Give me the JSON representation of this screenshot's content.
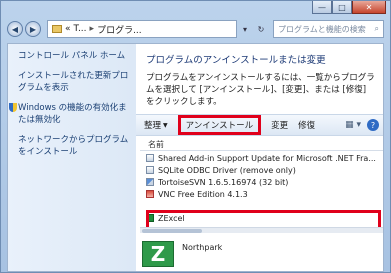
{
  "window": {
    "caption_minimize": "—",
    "caption_maximize": "□",
    "caption_close": "✕"
  },
  "address_bar": {
    "icon": "folder-icon",
    "part1": "«",
    "part2": "T...",
    "separator": "▸",
    "part3": "プログラ...",
    "dropdown": "▾",
    "refresh": "↻",
    "search_placeholder": "プログラムと機能の検索",
    "search_icon": "⌕"
  },
  "sidebar": {
    "items": [
      {
        "label": "コントロール パネル ホーム"
      },
      {
        "label": "インストールされた更新プログラムを表示"
      },
      {
        "label": "Windows の機能の有効化または無効化"
      },
      {
        "label": "ネットワークからプログラムをインストール"
      }
    ]
  },
  "main": {
    "title": "プログラムのアンインストールまたは変更",
    "description": "プログラムをアンインストールするには、一覧からプログラムを選択して [アンインストール]、[変更]、または [修復] をクリックします。"
  },
  "toolbar": {
    "organize": "整理",
    "uninstall": "アンインストール",
    "change": "変更",
    "repair": "修復"
  },
  "list": {
    "column_name": "名前",
    "rows": [
      {
        "name": "Shared Add-in Support Update for Microsoft .NET Fra..."
      },
      {
        "name": "SQLite ODBC Driver (remove only)"
      },
      {
        "name": "TortoiseSVN 1.6.5.16974 (32 bit)"
      },
      {
        "name": "VNC Free Edition 4.1.3"
      },
      {
        "name": "ZExcel"
      }
    ]
  },
  "details": {
    "icon_letter": "Z",
    "publisher": "Northpark"
  },
  "colors": {
    "highlight_red": "#e0001b",
    "link_blue": "#1a3f73"
  }
}
